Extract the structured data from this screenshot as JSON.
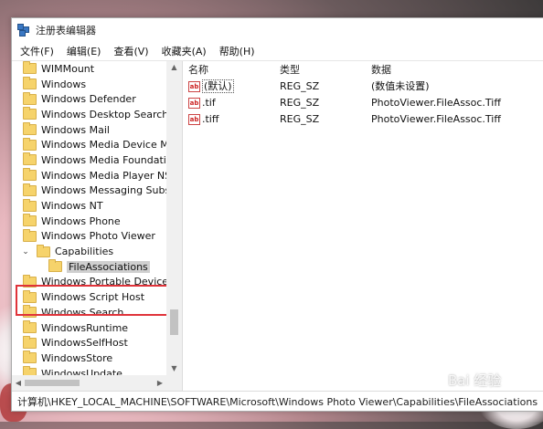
{
  "window": {
    "title": "注册表编辑器"
  },
  "menu": [
    "文件(F)",
    "编辑(E)",
    "查看(V)",
    "收藏夹(A)",
    "帮助(H)"
  ],
  "tree": {
    "items": [
      {
        "label": "WIMMount",
        "level": 0
      },
      {
        "label": "Windows",
        "level": 0
      },
      {
        "label": "Windows Defender",
        "level": 0
      },
      {
        "label": "Windows Desktop Search",
        "level": 0
      },
      {
        "label": "Windows Mail",
        "level": 0
      },
      {
        "label": "Windows Media Device Mana",
        "level": 0
      },
      {
        "label": "Windows Media Foundation",
        "level": 0
      },
      {
        "label": "Windows Media Player NSS",
        "level": 0
      },
      {
        "label": "Windows Messaging Subsyst",
        "level": 0
      },
      {
        "label": "Windows NT",
        "level": 0
      },
      {
        "label": "Windows Phone",
        "level": 0
      },
      {
        "label": "Windows Photo Viewer",
        "level": 0
      },
      {
        "label": "Capabilities",
        "level": 1,
        "expanded": true
      },
      {
        "label": "FileAssociations",
        "level": 2,
        "selected": true
      },
      {
        "label": "Windows Portable Devices",
        "level": 0
      },
      {
        "label": "Windows Script Host",
        "level": 0
      },
      {
        "label": "Windows Search",
        "level": 0
      },
      {
        "label": "WindowsRuntime",
        "level": 0
      },
      {
        "label": "WindowsSelfHost",
        "level": 0
      },
      {
        "label": "WindowsStore",
        "level": 0
      },
      {
        "label": "WindowsUpdate",
        "level": 0
      }
    ]
  },
  "values": {
    "headers": {
      "name": "名称",
      "type": "类型",
      "data": "数据"
    },
    "rows": [
      {
        "name": "(默认)",
        "type": "REG_SZ",
        "data": "(数值未设置)"
      },
      {
        "name": ".tif",
        "type": "REG_SZ",
        "data": "PhotoViewer.FileAssoc.Tiff"
      },
      {
        "name": ".tiff",
        "type": "REG_SZ",
        "data": "PhotoViewer.FileAssoc.Tiff"
      }
    ],
    "value_icon": "ab"
  },
  "status": {
    "path": "计算机\\HKEY_LOCAL_MACHINE\\SOFTWARE\\Microsoft\\Windows Photo Viewer\\Capabilities\\FileAssociations"
  },
  "watermark": "Bai 经验",
  "colors": {
    "highlight": "#e0333a",
    "folder": "#f6d36b",
    "selection": "#cfcfcf"
  }
}
